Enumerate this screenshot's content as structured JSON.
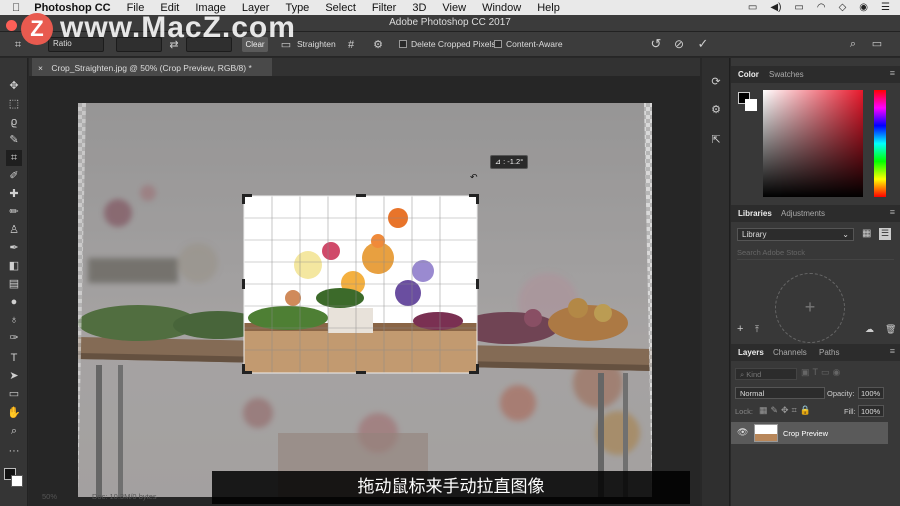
{
  "menubar": {
    "app": "Photoshop CC",
    "items": [
      "File",
      "Edit",
      "Image",
      "Layer",
      "Type",
      "Select",
      "Filter",
      "3D",
      "View",
      "Window",
      "Help"
    ]
  },
  "window": {
    "title": "Adobe Photoshop CC 2017"
  },
  "options": {
    "ratio": "Ratio",
    "clear": "Clear",
    "straighten": "Straighten",
    "delete_cropped": "Delete Cropped Pixels",
    "content_aware": "Content-Aware"
  },
  "document": {
    "tab_title": "Crop_Straighten.jpg @ 50% (Crop Preview, RGB/8) *",
    "close": "×",
    "angle_readout": "⊿ : -1.2°",
    "zoom": "50%",
    "doc_info": "Doc: 10.3M/0 bytes"
  },
  "panels": {
    "color": {
      "tabs": [
        "Color",
        "Swatches"
      ]
    },
    "libraries": {
      "tabs": [
        "Libraries",
        "Adjustments"
      ],
      "library": "Library",
      "search_placeholder": "Search Adobe Stock"
    },
    "layers": {
      "tabs": [
        "Layers",
        "Channels",
        "Paths"
      ],
      "kind": "Kind",
      "blend": "Normal",
      "opacity_label": "Opacity:",
      "opacity": "100%",
      "lock_label": "Lock:",
      "fill_label": "Fill:",
      "fill": "100%",
      "layer_name": "Crop Preview"
    }
  },
  "subtitle": "拖动鼠标来手动拉直图像",
  "watermark": {
    "text": "www.MacZ.com",
    "logo": "Z"
  }
}
